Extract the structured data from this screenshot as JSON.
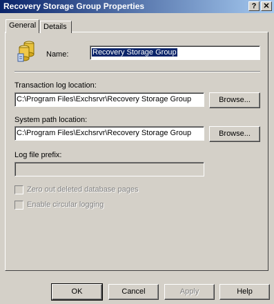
{
  "window": {
    "title": "Recovery Storage Group Properties",
    "help_glyph": "?",
    "close_glyph": "✕"
  },
  "tabs": [
    {
      "label": "General",
      "selected": true
    },
    {
      "label": "Details",
      "selected": false
    }
  ],
  "general": {
    "name_label": "Name:",
    "name_value": "Recovery Storage Group",
    "transaction_log_label": "Transaction log location:",
    "transaction_log_value": "C:\\Program Files\\Exchsrvr\\Recovery Storage Group",
    "system_path_label": "System path location:",
    "system_path_value": "C:\\Program Files\\Exchsrvr\\Recovery Storage Group",
    "browse_label": "Browse...",
    "log_prefix_label": "Log file prefix:",
    "log_prefix_value": "",
    "zero_out_label": "Zero out deleted database pages",
    "circular_logging_label": "Enable circular logging"
  },
  "buttons": {
    "ok": "OK",
    "cancel": "Cancel",
    "apply": "Apply",
    "help": "Help"
  },
  "icons": {
    "storage_group": "storage-group-icon"
  }
}
